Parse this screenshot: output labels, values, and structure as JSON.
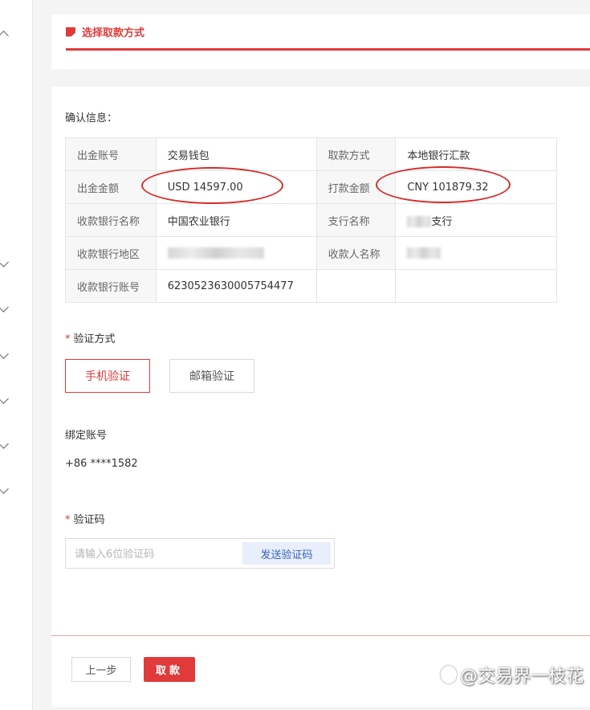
{
  "header": {
    "title": "选择取款方式"
  },
  "confirm": {
    "label": "确认信息：",
    "rows": [
      {
        "k1": "出金账号",
        "v1": "交易钱包",
        "k2": "取款方式",
        "v2": "本地银行汇款"
      },
      {
        "k1": "出金金额",
        "v1": "USD 14597.00",
        "k2": "打款金额",
        "v2": "CNY 101879.32"
      },
      {
        "k1": "收款银行名称",
        "v1": "中国农业银行",
        "k2": "支行名称",
        "v2": "支行"
      },
      {
        "k1": "收款银行地区",
        "v1": "",
        "k2": "收款人名称",
        "v2": ""
      },
      {
        "k1": "收款银行账号",
        "v1": "6230523630005754477",
        "k2": "",
        "v2": ""
      }
    ]
  },
  "verify": {
    "label": "验证方式",
    "options": [
      "手机验证",
      "邮箱验证"
    ],
    "selected": "手机验证"
  },
  "bound": {
    "label": "绑定账号",
    "value": "+86 ****1582"
  },
  "code": {
    "label": "验证码",
    "placeholder": "请输入6位验证码",
    "value": "",
    "send_label": "发送验证码"
  },
  "footer": {
    "prev_label": "上一步",
    "submit_label": "取款"
  },
  "watermark": {
    "text": "@交易界一枝花"
  },
  "colors": {
    "accent": "#e03a3a",
    "annotation": "#d62b2b",
    "send_bg": "#e8eefb"
  }
}
